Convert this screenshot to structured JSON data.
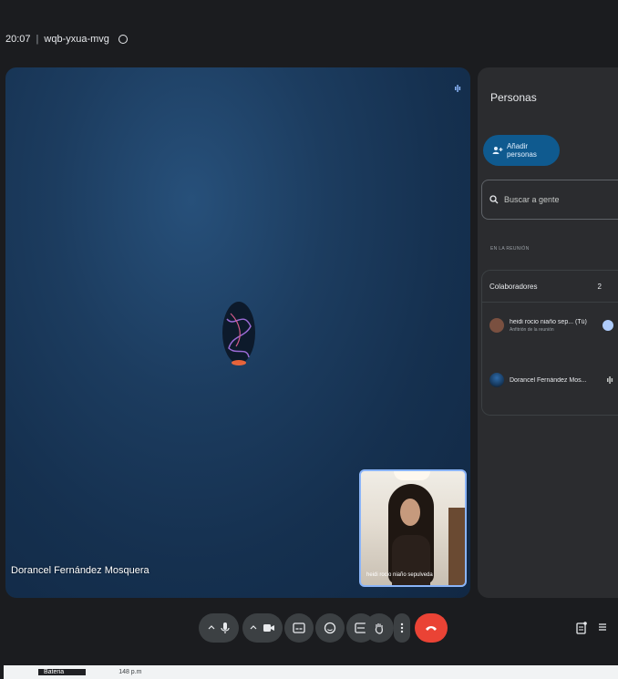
{
  "meeting": {
    "time": "20:07",
    "separator": "|",
    "code": "wqb-yxua-mvg"
  },
  "stage": {
    "presenter_name": "Dorancel Fernández Mosquera"
  },
  "self_view": {
    "name": "heidi rocio niaño sepulveda"
  },
  "people_panel": {
    "title": "Personas",
    "add_button": "Añadir personas",
    "search_placeholder": "Buscar a gente",
    "section_label": "EN LA REUNIÓN",
    "group_title": "Colaboradores",
    "group_count": "2",
    "participants": [
      {
        "name": "heidi rocio niaño sep... (Tú)",
        "role": "Anfitrión de la reunión"
      },
      {
        "name": "Dorancel Fernández Mos...",
        "role": ""
      }
    ]
  },
  "bottom_strip": {
    "left": "Bateria",
    "middle": "148 p.m"
  },
  "colors": {
    "end_call": "#ea4335",
    "accent": "#8ab4f8",
    "add_button_bg": "#0f5a8f"
  }
}
